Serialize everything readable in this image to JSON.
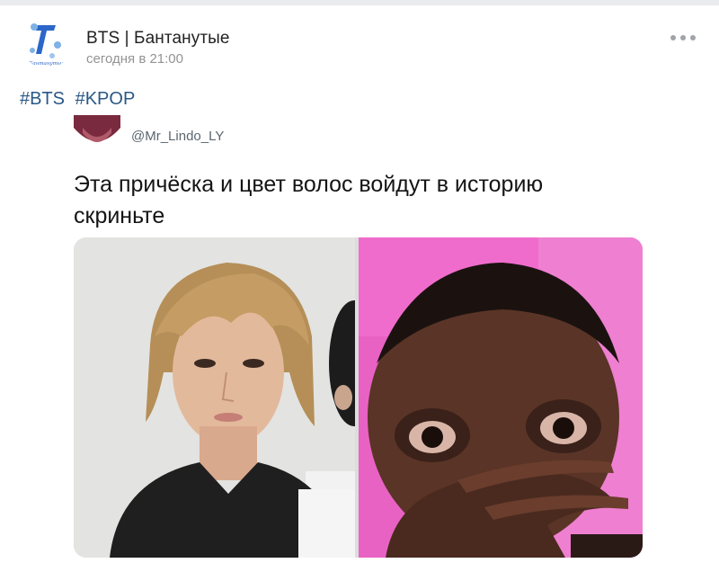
{
  "post": {
    "group_name": "BTS | Бантанутые",
    "time": "сегодня в 21:00",
    "avatar_caption": "Бантанутые",
    "hashtags": [
      "#BTS",
      "#KPOP"
    ]
  },
  "tweet": {
    "handle": "@Mr_Lindo_LY",
    "text_line1": "Эта причёска и цвет волос войдут в историю",
    "text_line2": "скриньте"
  },
  "colors": {
    "link": "#2a5885",
    "secondary_text": "#939393",
    "pink_background": "#e95fc3"
  },
  "icons": {
    "more": "more-horizontal-icon"
  }
}
